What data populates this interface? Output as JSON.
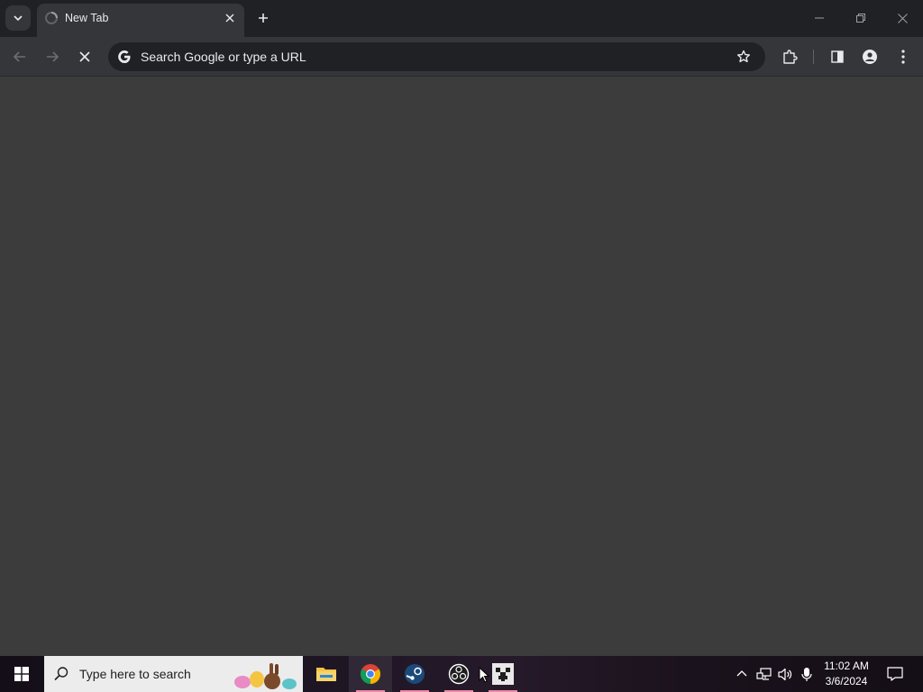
{
  "browser": {
    "tab": {
      "title": "New Tab"
    },
    "omnibox": {
      "placeholder": "Search Google or type a URL",
      "value": ""
    },
    "loading": true
  },
  "taskbar": {
    "search_placeholder": "Type here to search",
    "apps": [
      {
        "name": "File Explorer",
        "icon": "folder-icon"
      },
      {
        "name": "Google Chrome",
        "icon": "chrome-icon"
      },
      {
        "name": "Steam",
        "icon": "steam-icon"
      },
      {
        "name": "OBS Studio",
        "icon": "obs-icon"
      },
      {
        "name": "Minecraft",
        "icon": "minecraft-icon"
      }
    ],
    "clock": {
      "time": "11:02 AM",
      "date": "3/6/2024"
    }
  },
  "colors": {
    "titlebar": "#202124",
    "toolbar": "#35363a",
    "page": "#3c3c3c",
    "taskbar_accent": "#f08aa6"
  }
}
